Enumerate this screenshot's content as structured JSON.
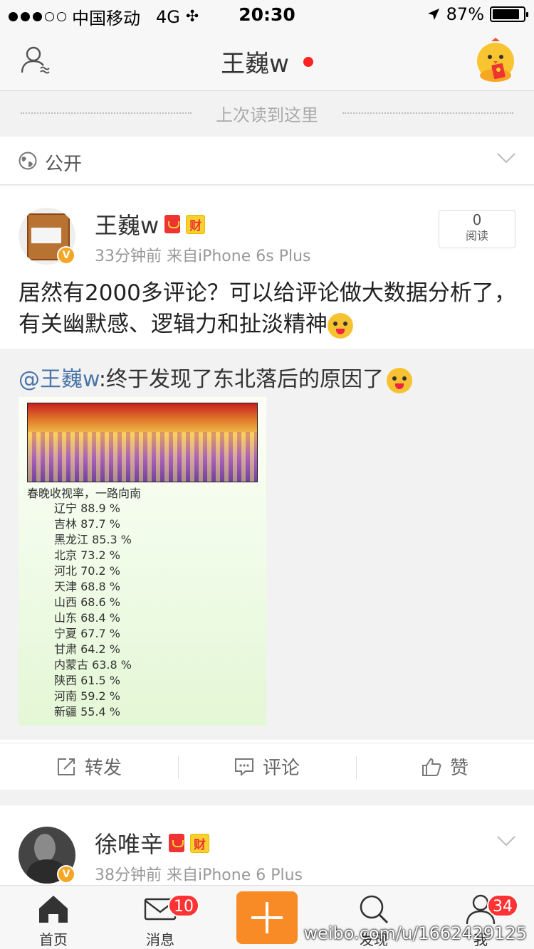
{
  "status_bar": {
    "carrier": "中国移动",
    "network": "4G",
    "time": "20:30",
    "battery": "87%",
    "battery_level": 0.87
  },
  "nav": {
    "title": "王巍w"
  },
  "last_read": "上次读到这里",
  "group": {
    "label": "公开"
  },
  "post": {
    "username": "王巍w",
    "cai_badge": "财",
    "meta": "33分钟前  来自iPhone 6s Plus",
    "read_count": "0",
    "read_label": "阅读",
    "text": "居然有2000多评论？可以给评论做大数据分析了，有关幽默感、逻辑力和扯淡精神",
    "repost": {
      "mention": "@王巍w",
      "text": ":终于发现了东北落后的原因了",
      "image_title": "春晚收视率，一路向南",
      "ratings": [
        "辽宁 88.9 %",
        "吉林 87.7 %",
        "黑龙江 85.3 %",
        "北京 73.2 %",
        "河北 70.2 %",
        "天津 68.8 %",
        "山西 68.6 %",
        "山东 68.4 %",
        "宁夏 67.7 %",
        "甘肃 64.2 %",
        "内蒙古 63.8 %",
        "陕西 61.5 %",
        "河南 59.2 %",
        "新疆 55.4 %"
      ]
    },
    "actions": {
      "forward": "转发",
      "comment": "评论",
      "like": "赞"
    }
  },
  "post2": {
    "username": "徐唯辛",
    "cai_badge": "财",
    "meta": "38分钟前  来自iPhone 6 Plus"
  },
  "tabbar": {
    "home": "首页",
    "messages": "消息",
    "messages_badge": "10",
    "discover": "发现",
    "me": "我",
    "me_badge": "34"
  },
  "watermark": "weibo.com/u/1662429125",
  "colors": {
    "accent_orange": "#f98b26",
    "badge_red": "#ff3333",
    "mention_blue": "#4a76a8"
  }
}
